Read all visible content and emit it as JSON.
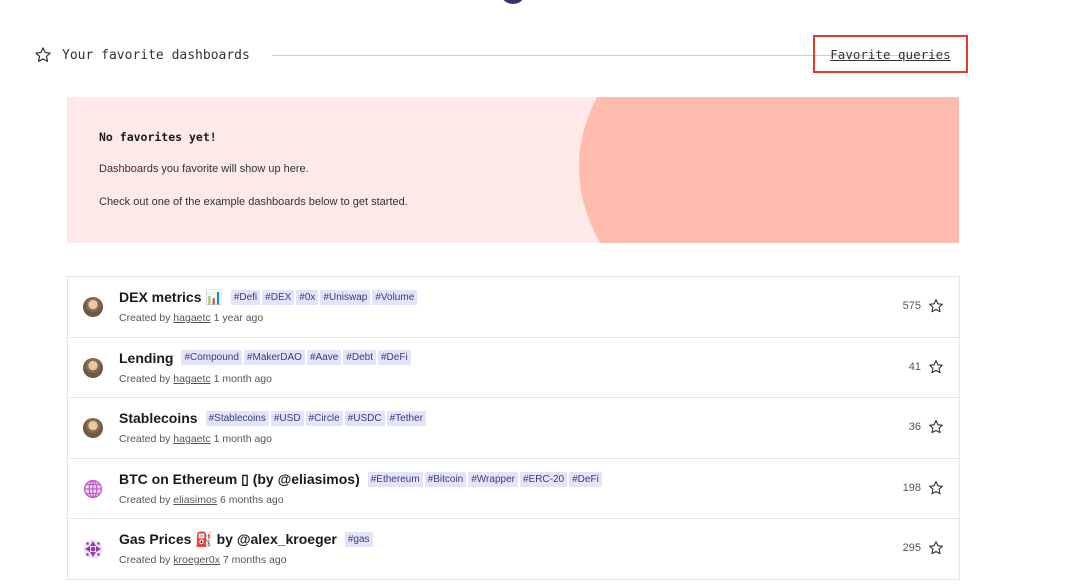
{
  "favorites": {
    "header_title": "Your favorite dashboards",
    "favorite_queries_link": "Favorite queries",
    "empty_heading": "No favorites yet!",
    "empty_line1": "Dashboards you favorite will show up here.",
    "empty_line2": "Check out one of the example dashboards below to get started."
  },
  "dashboards": [
    {
      "title": "DEX metrics 📊",
      "tags": [
        "#Defi",
        "#DEX",
        "#0x",
        "#Uniswap",
        "#Volume"
      ],
      "created_prefix": "Created by",
      "author": "hagaetc",
      "age": "1 year ago",
      "stars": "575",
      "avatar_icon": "user-photo"
    },
    {
      "title": "Lending",
      "tags": [
        "#Compound",
        "#MakerDAO",
        "#Aave",
        "#Debt",
        "#DeFi"
      ],
      "created_prefix": "Created by",
      "author": "hagaetc",
      "age": "1 month ago",
      "stars": "41",
      "avatar_icon": "user-photo"
    },
    {
      "title": "Stablecoins",
      "tags": [
        "#Stablecoins",
        "#USD",
        "#Circle",
        "#USDC",
        "#Tether"
      ],
      "created_prefix": "Created by",
      "author": "hagaetc",
      "age": "1 month ago",
      "stars": "36",
      "avatar_icon": "user-photo"
    },
    {
      "title": "BTC on Ethereum ▯ (by @eliasimos)",
      "tags": [
        "#Ethereum",
        "#Bitcoin",
        "#Wrapper",
        "#ERC-20",
        "#DeFi"
      ],
      "created_prefix": "Created by",
      "author": "eliasimos",
      "age": "6 months ago",
      "stars": "198",
      "avatar_icon": "globe-pattern"
    },
    {
      "title": "Gas Prices ⛽ by @alex_kroeger",
      "tags": [
        "#gas"
      ],
      "created_prefix": "Created by",
      "author": "kroeger0x",
      "age": "7 months ago",
      "stars": "295",
      "avatar_icon": "geometric-pattern"
    }
  ],
  "colors": {
    "accent_red": "#e33a2c",
    "panel_bg": "#fde9e7",
    "panel_blob": "#ffbcae",
    "tag_bg": "#e3e3fa"
  }
}
